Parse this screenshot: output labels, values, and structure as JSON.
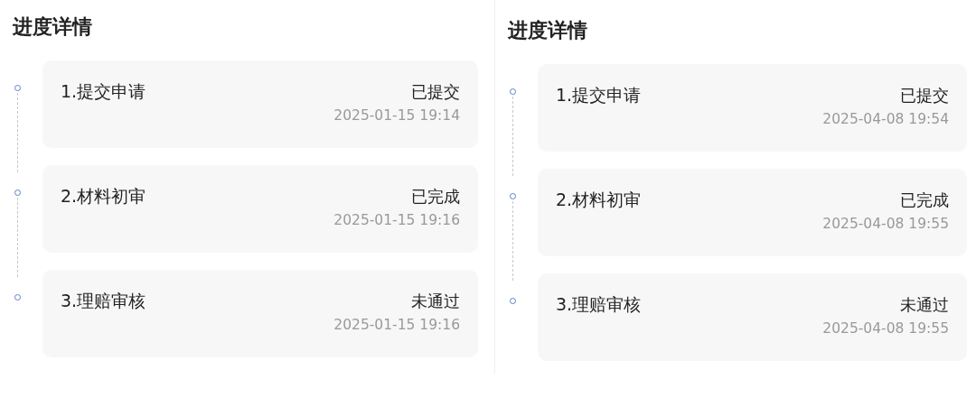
{
  "panels": [
    {
      "title": "进度详情",
      "steps": [
        {
          "label": "1.提交申请",
          "status": "已提交",
          "time": "2025-01-15 19:14"
        },
        {
          "label": "2.材料初审",
          "status": "已完成",
          "time": "2025-01-15 19:16"
        },
        {
          "label": "3.理赔审核",
          "status": "未通过",
          "time": "2025-01-15 19:16"
        }
      ]
    },
    {
      "title": "进度详情",
      "steps": [
        {
          "label": "1.提交申请",
          "status": "已提交",
          "time": "2025-04-08 19:54"
        },
        {
          "label": "2.材料初审",
          "status": "已完成",
          "time": "2025-04-08 19:55"
        },
        {
          "label": "3.理赔审核",
          "status": "未通过",
          "time": "2025-04-08 19:55"
        }
      ]
    }
  ]
}
